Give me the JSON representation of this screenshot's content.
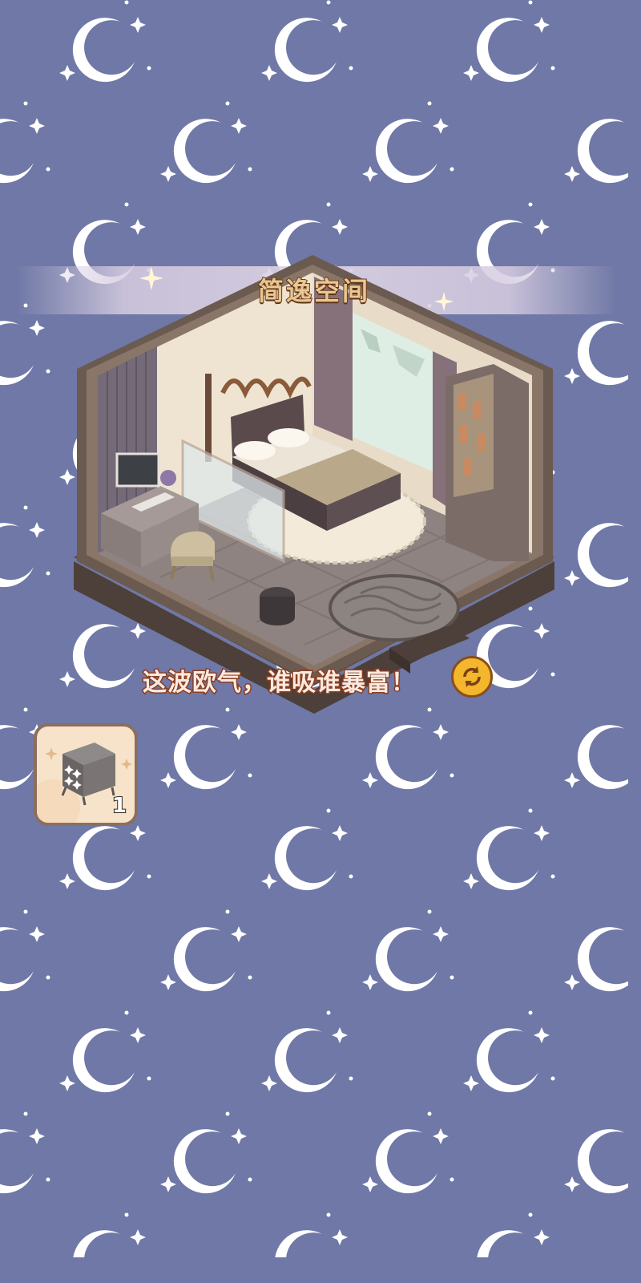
{
  "room": {
    "title": "简逸空间",
    "slogan": "这波欧气，谁吸谁暴富！"
  },
  "refresh": {
    "icon": "refresh-icon"
  },
  "reward_item": {
    "icon": "bedside-cabinet-icon",
    "count": "1"
  },
  "colors": {
    "background": "#6f78a6",
    "moon": "#ffffff",
    "title_fill": "#e9c692",
    "title_stroke": "#6b3d1d",
    "slogan_stroke": "#8a3f22",
    "button": "#f3b62c"
  }
}
